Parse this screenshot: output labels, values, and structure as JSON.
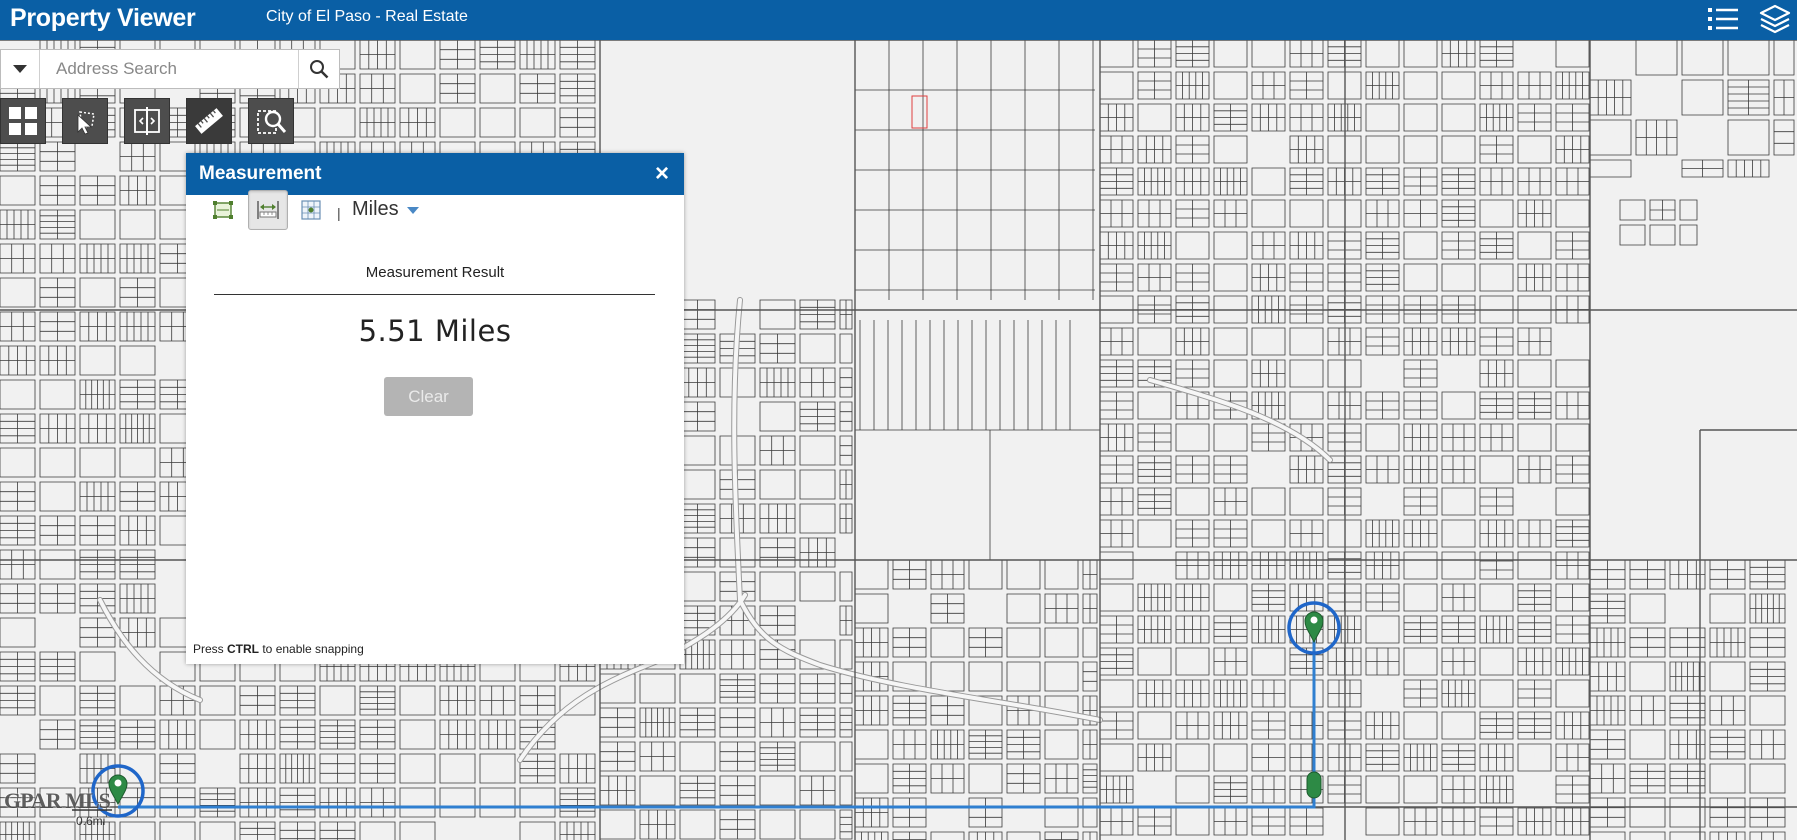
{
  "header": {
    "app_title": "Property Viewer",
    "app_subtitle": "City of El Paso - Real Estate",
    "icons": [
      "legend-list-icon",
      "layers-icon"
    ]
  },
  "search": {
    "placeholder": "Address Search",
    "value": ""
  },
  "toolbar": {
    "tools": [
      "basemap-gallery-icon",
      "select-icon",
      "swipe-icon",
      "measure-ruler-icon",
      "identify-icon"
    ],
    "active_tool": "measure"
  },
  "measurement": {
    "title": "Measurement",
    "close_label": "×",
    "tools": [
      "area-tool-icon",
      "distance-tool-icon",
      "location-tool-icon"
    ],
    "active_tool": "distance",
    "separator": "|",
    "unit": "Miles",
    "result_label": "Measurement Result",
    "result_value": "5.51 Miles",
    "clear_label": "Clear",
    "hint_prefix": "Press ",
    "hint_key": "CTRL",
    "hint_suffix": " to enable snapping"
  },
  "map": {
    "scale_label": "0.6mi",
    "watermark": "GPAR MLS",
    "line_color": "#2f7fd0",
    "marker_color": "#2d8a45"
  }
}
